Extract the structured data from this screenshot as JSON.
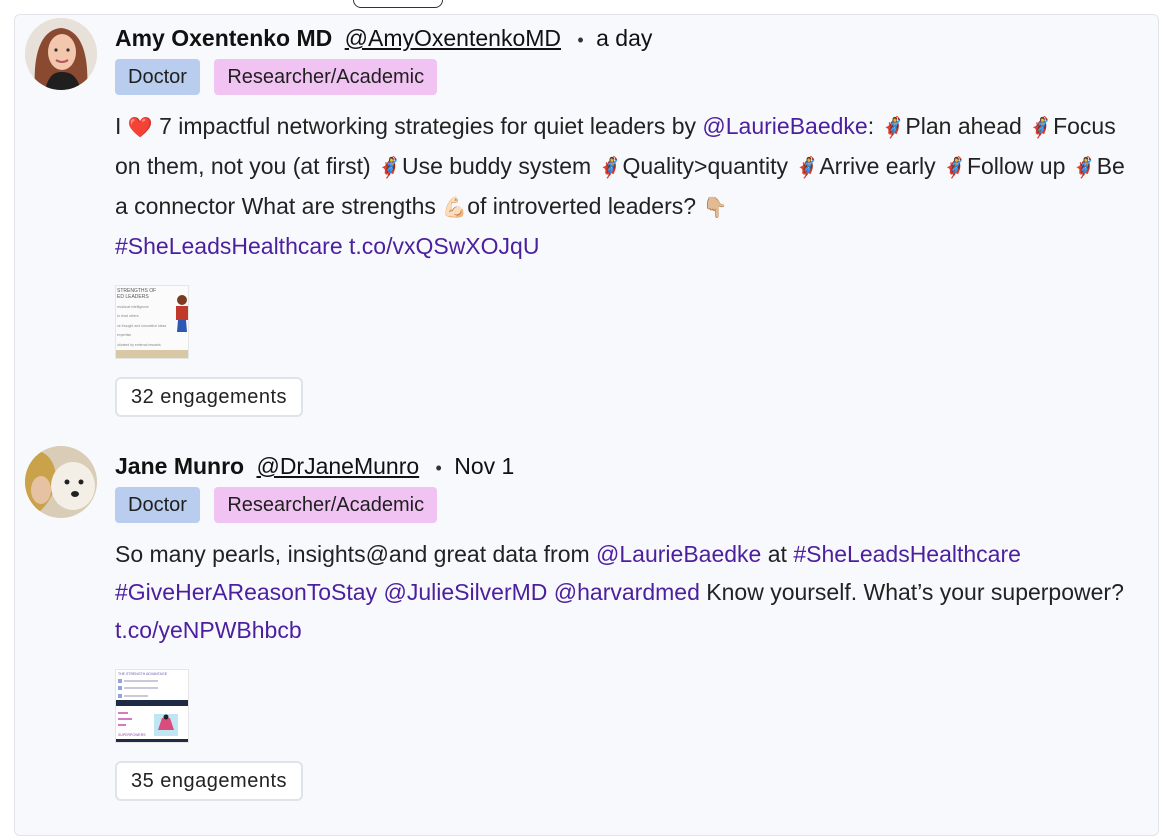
{
  "posts": [
    {
      "name": "Amy Oxentenko MD",
      "handle": "@AmyOxentenkoMD",
      "time": "a day",
      "badges": [
        "Doctor",
        "Researcher/Academic"
      ],
      "text": {
        "t1": "I ",
        "heart": "❤️",
        "t2": " 7 impactful networking strategies for quiet leaders by ",
        "mention1": "@LaurieBaedke",
        "t3": ": ",
        "e1": "🦸‍♀️",
        "t4": "Plan ahead ",
        "e2": "🦸‍♀️",
        "t5": "Focus on them, not you (at first) ",
        "e3": "🦸‍♀️",
        "t6": "Use buddy system ",
        "e4": "🦸‍♀️",
        "t7": "Quality>quantity ",
        "e5": "🦸‍♀️",
        "t8": "Arrive early ",
        "e6": "🦸‍♀️",
        "t9": "Follow up ",
        "e7": "🦸‍♀️",
        "t10": "Be a connector What are strengths ",
        "e8": "💪🏻",
        "t11": "of introverted leaders? ",
        "e9": "👇🏼",
        "hashtag": "#SheLeadsHealthcare",
        "link": "t.co/vxQSwXOJqU"
      },
      "thumb": {
        "lines": [
          "STRENGTHS OF",
          "ED LEADERS",
          "motional intelligence",
          "to read others",
          "ve thought and innovative ideas",
          "expertise",
          "otivated by external rewards"
        ]
      },
      "engagements": "32 engagements"
    },
    {
      "name": "Jane Munro",
      "handle": "@DrJaneMunro",
      "time": "Nov 1",
      "badges": [
        "Doctor",
        "Researcher/Academic"
      ],
      "text": {
        "t1": "So many pearls, insights@and great data from ",
        "mention1": "@LaurieBaedke",
        "t2": " at ",
        "hashtag1": "#SheLeadsHealthcare",
        "hashtag2": "#GiveHerAReasonToStay",
        "mention2": "@JulieSilverMD",
        "mention3": "@harvardmed",
        "t3": " Know yourself. What’s your superpower? ",
        "link": "t.co/yeNPWBhbcb"
      },
      "thumb": {
        "lines": [
          "THE STRENGTH ADVANTAGE",
          "SUPERPOWERS"
        ]
      },
      "engagements": "35 engagements"
    }
  ],
  "colors": {
    "link": "#4b1f9e",
    "doctor_badge": "#b9cdee",
    "research_badge": "#f1c3f3",
    "card_bg": "#f8f9fc"
  }
}
